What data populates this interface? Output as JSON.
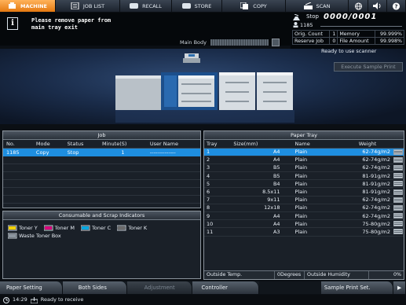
{
  "tabs": [
    {
      "label": "MACHINE"
    },
    {
      "label": "JOB LIST"
    },
    {
      "label": "RECALL"
    },
    {
      "label": "STORE"
    },
    {
      "label": "COPY"
    },
    {
      "label": "SCAN"
    }
  ],
  "message": {
    "text": "Please remove paper from\nmain tray exit",
    "main_body_label": "Main Body"
  },
  "status": {
    "state": "Stop",
    "counter": "0000/0001",
    "user": "1185",
    "orig_count_label": "Orig. Count",
    "orig_count": "1",
    "memory_label": "Memory",
    "memory": "99.999%",
    "reserve_job_label": "Reserve Job",
    "reserve_job": "0",
    "file_amount_label": "File Amount",
    "file_amount": "99.998%",
    "ready": "Ready to use scanner"
  },
  "execute_sample_print": "Execute Sample Print",
  "job": {
    "title": "Job",
    "headers": {
      "no": "No.",
      "mode": "Mode",
      "status": "Status",
      "minute": "Minute(S)",
      "user": "User Name"
    },
    "rows": [
      {
        "no": "1185",
        "mode": "Copy",
        "status": "Stop",
        "minute": "1",
        "user": "--------------"
      }
    ]
  },
  "consumables": {
    "title": "Consumable and Scrap Indicators",
    "items": [
      "Toner Y",
      "Toner M",
      "Toner C",
      "Toner K",
      "Waste Toner Box"
    ],
    "colors": {
      "y": "#f2d100",
      "m": "#d8007a",
      "c": "#00a7e1",
      "k": "#2a2a2a"
    }
  },
  "tray": {
    "title": "Paper Tray",
    "headers": {
      "tray": "Tray",
      "size": "Size(mm)",
      "name": "Name",
      "weight": "Weight"
    },
    "rows": [
      {
        "tray": "1",
        "size": "A4",
        "name": "Plain",
        "weight": "62-74g/m2"
      },
      {
        "tray": "2",
        "size": "A4",
        "name": "Plain",
        "weight": "62-74g/m2"
      },
      {
        "tray": "3",
        "size": "B5",
        "name": "Plain",
        "weight": "62-74g/m2"
      },
      {
        "tray": "4",
        "size": "B5",
        "name": "Plain",
        "weight": "81-91g/m2"
      },
      {
        "tray": "5",
        "size": "B4",
        "name": "Plain",
        "weight": "81-91g/m2"
      },
      {
        "tray": "6",
        "size": "8.5x11",
        "name": "Plain",
        "weight": "81-91g/m2"
      },
      {
        "tray": "7",
        "size": "9x11",
        "name": "Plain",
        "weight": "62-74g/m2"
      },
      {
        "tray": "8",
        "size": "12x18",
        "name": "Plain",
        "weight": "62-74g/m2"
      },
      {
        "tray": "9",
        "size": "A4",
        "name": "Plain",
        "weight": "62-74g/m2"
      },
      {
        "tray": "10",
        "size": "A4",
        "name": "Plain",
        "weight": "75-80g/m2"
      },
      {
        "tray": "11",
        "size": "A3",
        "name": "Plain",
        "weight": "75-80g/m2"
      }
    ],
    "outside_temp_label": "Outside Temp.",
    "outside_temp": "0Degrees",
    "outside_humidity_label": "Outside Humidity",
    "outside_humidity": "0%"
  },
  "bottom_buttons": {
    "paper_setting": "Paper Setting",
    "both_sides": "Both Sides",
    "adjustment": "Adjustment",
    "controller": "Controller",
    "sample_print_set": "Sample Print Set."
  },
  "statusline": {
    "time": "14:29",
    "text": "Ready to receive"
  }
}
